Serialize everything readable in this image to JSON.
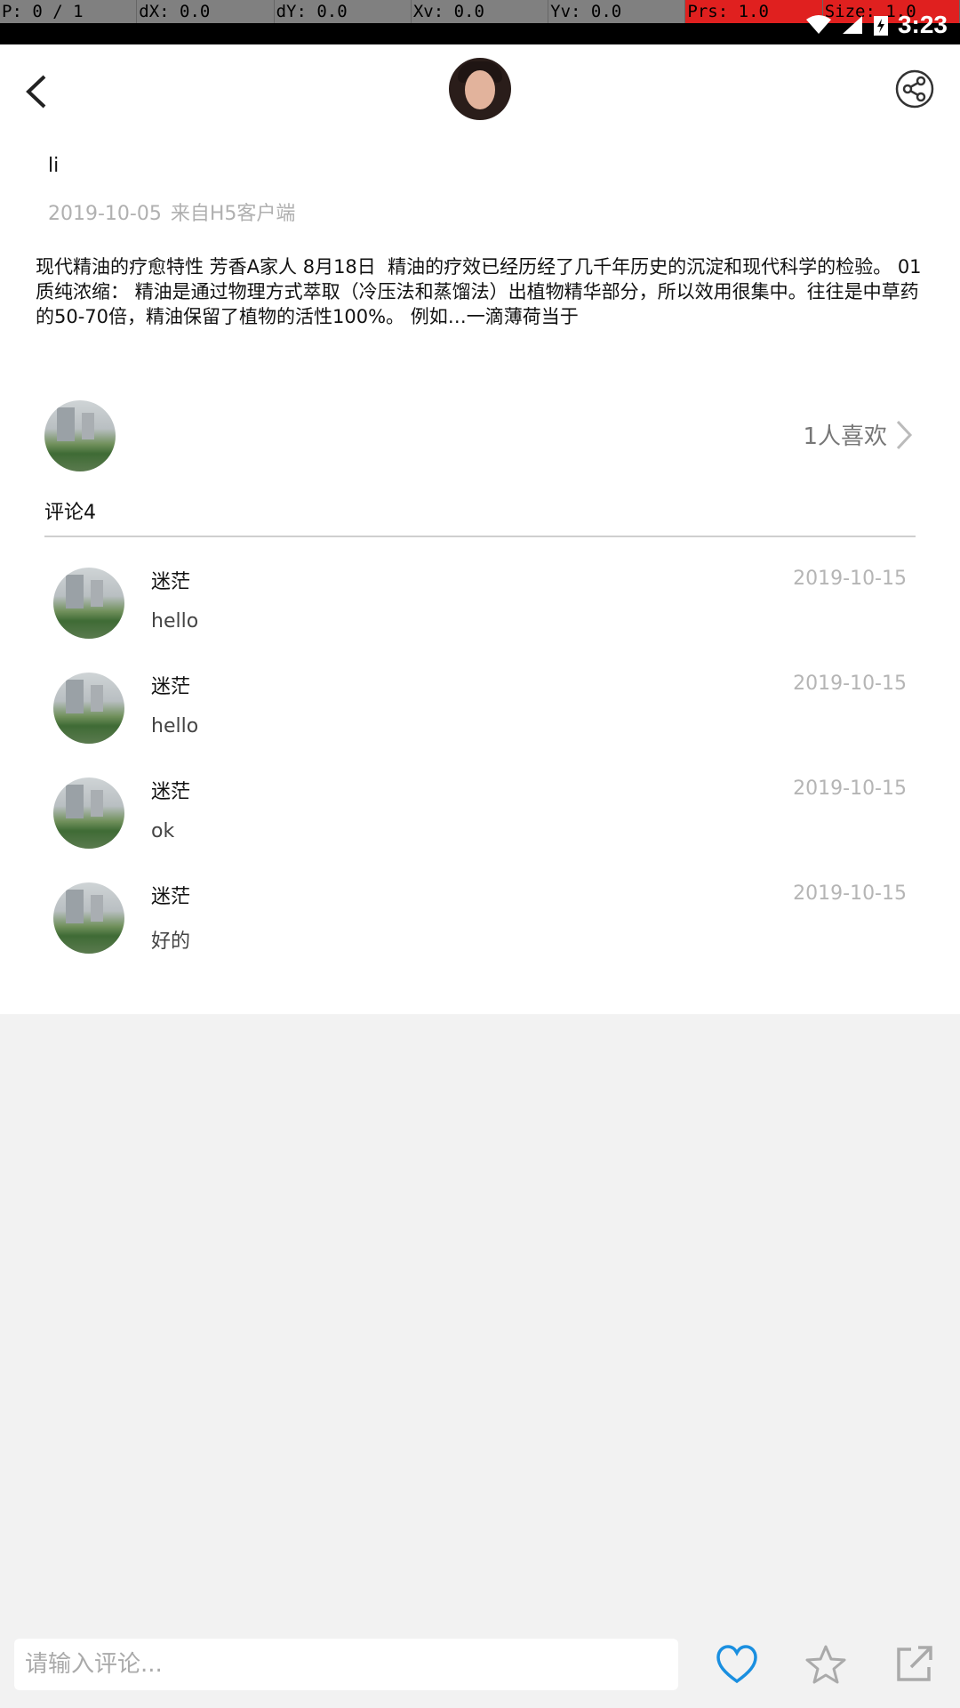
{
  "debug": {
    "pointer": "P: 0 / 1",
    "dx": "dX: 0.0",
    "dy": "dY: 0.0",
    "xv": "Xv: 0.0",
    "yv": "Yv: 0.0",
    "prs": "Prs: 1.0",
    "size": "Size: 1.0"
  },
  "status": {
    "time": "3:23"
  },
  "header": {
    "back_icon": "back-arrow-icon",
    "share_icon": "share-icon"
  },
  "post": {
    "author": "li",
    "date": "2019-10-05",
    "source": "来自H5客户端",
    "content": "现代精油的疗愈特性 芳香A家人 8月18日 ￼ ￼精油的疗效已经历经了几千年历史的沉淀和现代科学的检验。 01质纯浓缩： 精油是通过物理方式萃取（冷压法和蒸馏法）出植物精华部分，所以效用很集中。往往是中草药的50-70倍，精油保留了植物的活性100%。 例如…一滴薄荷当于"
  },
  "likes": {
    "label": "1人喜欢"
  },
  "comments": {
    "header": "评论4",
    "items": [
      {
        "name": "迷茫",
        "date": "2019-10-15",
        "text": "hello"
      },
      {
        "name": "迷茫",
        "date": "2019-10-15",
        "text": "hello"
      },
      {
        "name": "迷茫",
        "date": "2019-10-15",
        "text": "ok"
      },
      {
        "name": "迷茫",
        "date": "2019-10-15",
        "text": "好的"
      }
    ]
  },
  "bottom_bar": {
    "input_placeholder": "请输入评论...",
    "like_icon": "heart-icon",
    "favorite_icon": "star-icon",
    "external_icon": "open-external-icon",
    "accent_color": "#1a8fe0"
  }
}
